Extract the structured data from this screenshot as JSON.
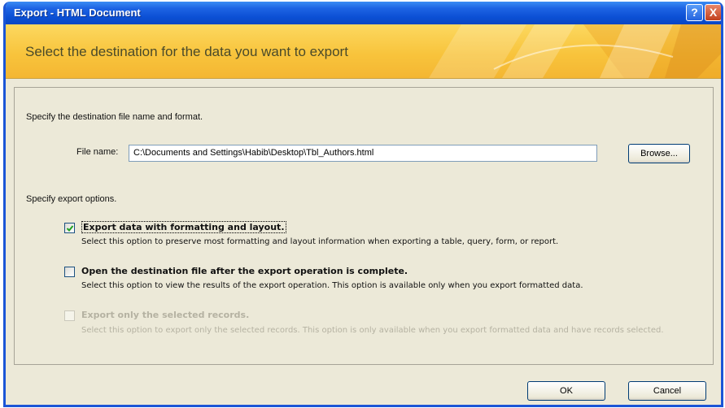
{
  "window": {
    "title": "Export - HTML Document",
    "help_label": "?",
    "close_label": "X"
  },
  "banner": {
    "heading": "Select the destination for the data you want to export"
  },
  "destination": {
    "section_label": "Specify the destination file name and format.",
    "file_name_label": "File name:",
    "file_name_value": "C:\\Documents and Settings\\Habib\\Desktop\\Tbl_Authors.html",
    "browse_label": "Browse..."
  },
  "export_options": {
    "section_label": "Specify export options.",
    "options": [
      {
        "label": "Export data with formatting and layout.",
        "description": "Select this option to preserve most formatting and layout information when exporting a table, query, form, or report.",
        "checked": true,
        "enabled": true
      },
      {
        "label": "Open the destination file after the export operation is complete.",
        "description": "Select this option to view the results of the export operation. This option is available only when you export formatted data.",
        "checked": false,
        "enabled": true
      },
      {
        "label": "Export only the selected records.",
        "description": "Select this option to export only the selected records. This option is only available when you export formatted data and have records selected.",
        "checked": false,
        "enabled": false
      }
    ]
  },
  "footer": {
    "ok_label": "OK",
    "cancel_label": "Cancel"
  },
  "colors": {
    "titlebar": "#0b4fd4",
    "banner": "#f8c43c",
    "dialog_bg": "#ece9d8"
  }
}
